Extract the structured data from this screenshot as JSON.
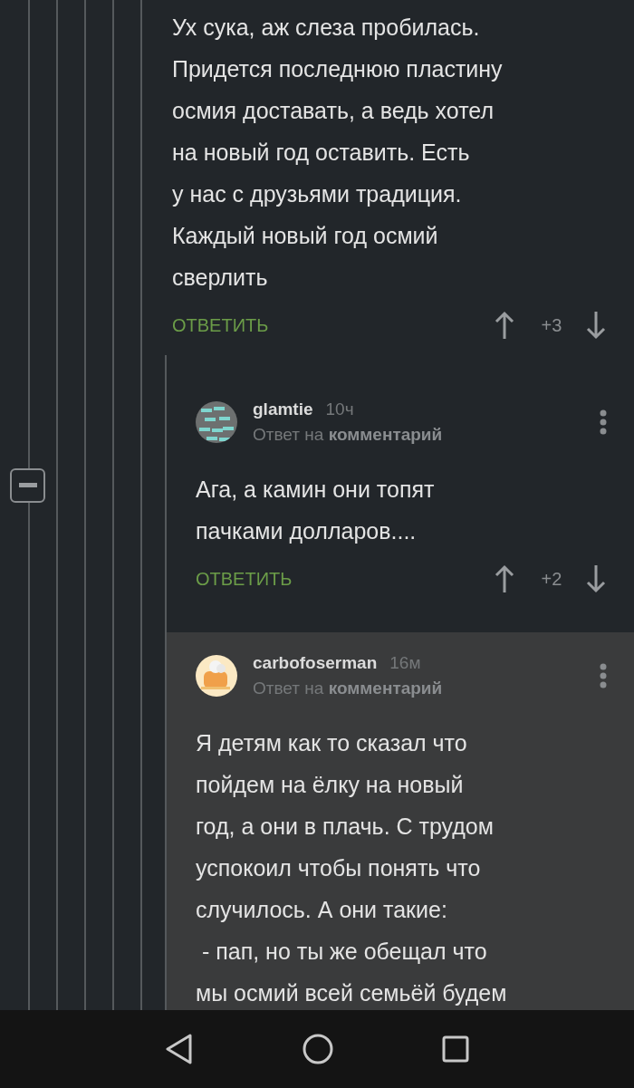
{
  "thread": {
    "collapse_button": {
      "expanded": true
    },
    "comment": {
      "text": "Ух сука, аж слеза пробилась.\nПридется последнюю пластину\nосмия доставать, а ведь хотел\nна новый год оставить. Есть\nу нас с друзьями традиция.\nКаждый новый год осмий\nсверлить",
      "reply": "ОТВЕТИТЬ",
      "score": "+3",
      "highlighted": false,
      "children": [
        {
          "author": "glamtie",
          "time": "10ч",
          "avatar": {
            "kind": "pattern"
          },
          "reply_to": "Ответ на **комментарий**",
          "text": "Ага, а камин они топят\nпачками долларов....",
          "reply": "ОТВЕТИТЬ",
          "score": "+2",
          "highlighted": false
        },
        {
          "author": "carbofoserman",
          "time": "16м",
          "avatar": {
            "kind": "toast"
          },
          "reply_to": "Ответ на **комментарий**",
          "text": "Я детям как то сказал что\nпойдем на ёлку на новый\nгод, а они в плачь. С трудом\nуспокоил чтобы понять что\nслучилось. А они такие:\n - пап, но ты же обещал что\nмы осмий всей семьёй будем",
          "highlighted": true
        }
      ]
    }
  }
}
